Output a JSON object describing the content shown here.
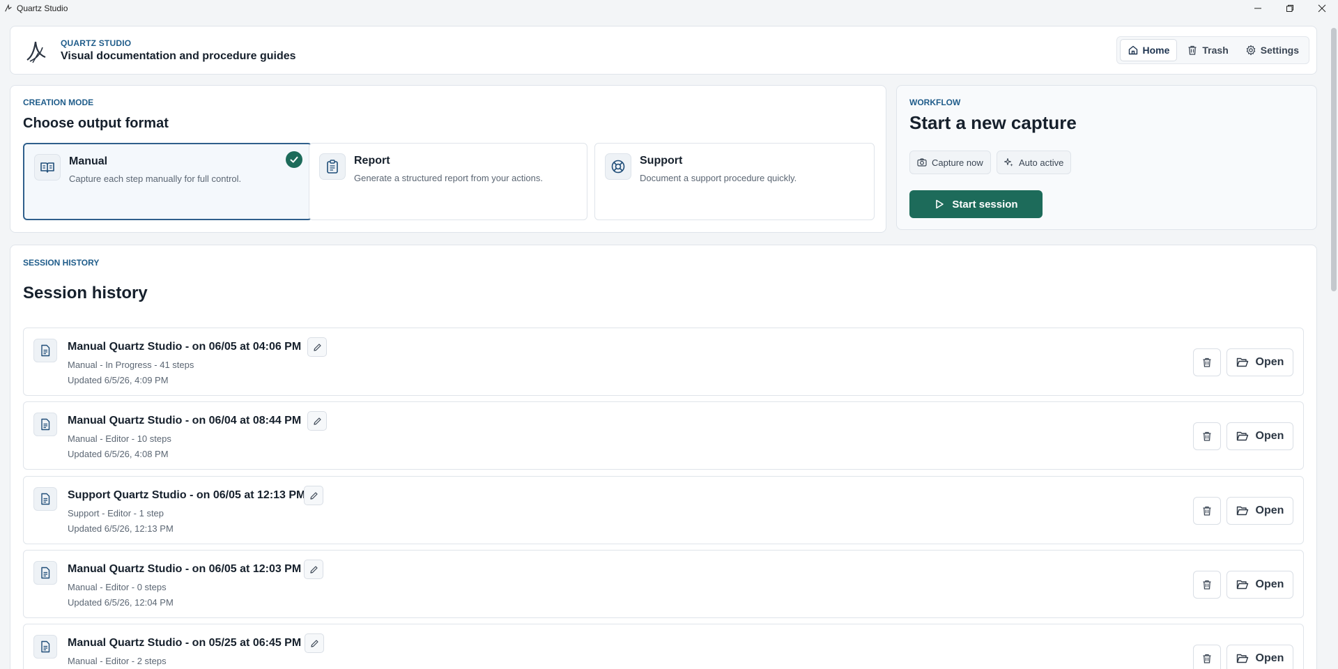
{
  "window": {
    "title": "Quartz Studio"
  },
  "header": {
    "eyebrow": "QUARTZ STUDIO",
    "title": "Visual documentation and procedure guides",
    "nav": [
      {
        "label": "Home",
        "icon": "home-icon",
        "active": true
      },
      {
        "label": "Trash",
        "icon": "trash-icon"
      },
      {
        "label": "Settings",
        "icon": "gear-icon"
      }
    ]
  },
  "creation": {
    "eyebrow": "CREATION MODE",
    "title": "Choose output format",
    "modes": [
      {
        "name": "Manual",
        "desc": "Capture each step manually for full control.",
        "icon": "book-icon",
        "selected": true
      },
      {
        "name": "Report",
        "desc": "Generate a structured report from your actions.",
        "icon": "clipboard-icon"
      },
      {
        "name": "Support",
        "desc": "Document a support procedure quickly.",
        "icon": "lifebuoy-icon"
      }
    ]
  },
  "workflow": {
    "eyebrow": "WORKFLOW",
    "title": "Start a new capture",
    "chips": [
      {
        "label": "Capture now",
        "icon": "camera-icon"
      },
      {
        "label": "Auto active",
        "icon": "sparkle-icon"
      }
    ],
    "start_label": "Start session"
  },
  "history": {
    "eyebrow": "SESSION HISTORY",
    "title": "Session history",
    "open_label": "Open",
    "sessions": [
      {
        "title": "Manual Quartz Studio - on 06/05 at 04:06 PM",
        "meta": "Manual - In Progress - 41 steps",
        "updated": "Updated 6/5/26, 4:09 PM"
      },
      {
        "title": "Manual Quartz Studio - on 06/04 at 08:44 PM",
        "meta": "Manual - Editor - 10 steps",
        "updated": "Updated 6/5/26, 4:08 PM"
      },
      {
        "title": "Support Quartz Studio - on 06/05 at 12:13 PM",
        "meta": "Support - Editor - 1 step",
        "updated": "Updated 6/5/26, 12:13 PM"
      },
      {
        "title": "Manual Quartz Studio - on 06/05 at 12:03 PM",
        "meta": "Manual - Editor - 0 steps",
        "updated": "Updated 6/5/26, 12:04 PM"
      },
      {
        "title": "Manual Quartz Studio - on 05/25 at 06:45 PM",
        "meta": "Manual - Editor - 2 steps",
        "updated": ""
      }
    ]
  },
  "colors": {
    "accent": "#1d6b5a",
    "eyebrow": "#1f5c8a",
    "selected_border": "#2f5f8c"
  }
}
